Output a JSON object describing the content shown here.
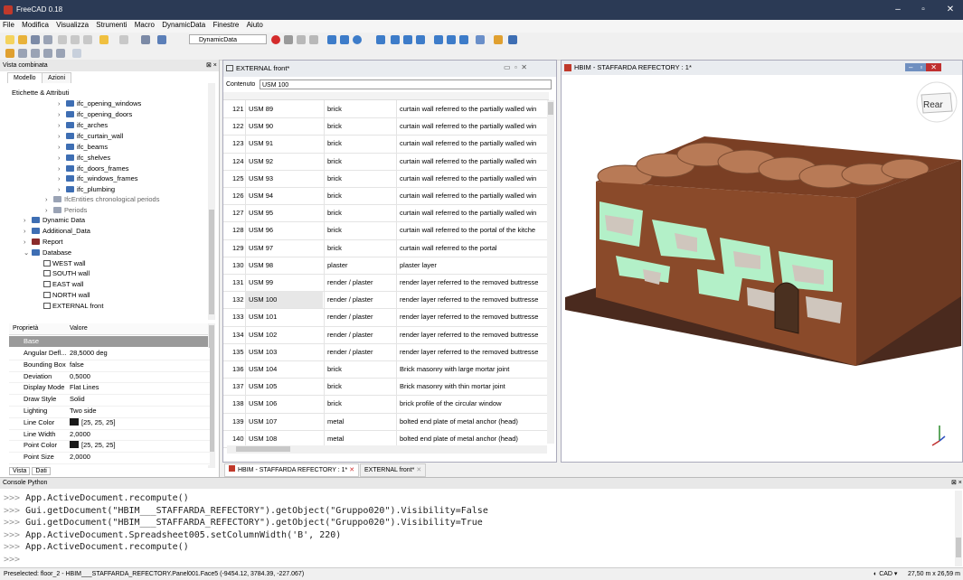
{
  "window": {
    "title": "FreeCAD 0.18",
    "min": "–",
    "max": "▫",
    "close": "✕"
  },
  "menu": [
    "File",
    "Modifica",
    "Visualizza",
    "Strumenti",
    "Macro",
    "DynamicData",
    "Finestre",
    "Aiuto"
  ],
  "toolbar": {
    "workbench": "DynamicData"
  },
  "combo": {
    "title": "Vista combinata",
    "tabs": [
      "Modello",
      "Azioni"
    ],
    "root": "Etichette & Attributi",
    "items": [
      "ifc_opening_windows",
      "ifc_opening_doors",
      "ifc_arches",
      "ifc_curtain_wall",
      "ifc_beams",
      "ifc_shelves",
      "ifc_doors_frames",
      "ifc_windows_frames",
      "ifc_plumbing",
      "IfcEntities chronological periods",
      "Periods",
      "Dynamic Data",
      "Additional_Data",
      "Report",
      "Database",
      "WEST wall",
      "SOUTH wall",
      "EAST wall",
      "NORTH wall",
      "EXTERNAL front"
    ]
  },
  "properties": {
    "col_prop": "Proprietà",
    "col_val": "Valore",
    "group": "Base",
    "rows": [
      {
        "k": "Angular Defl...",
        "v": "28,5000 deg"
      },
      {
        "k": "Bounding Box",
        "v": "false"
      },
      {
        "k": "Deviation",
        "v": "0,5000"
      },
      {
        "k": "Display Mode",
        "v": "Flat Lines"
      },
      {
        "k": "Draw Style",
        "v": "Solid"
      },
      {
        "k": "Lighting",
        "v": "Two side"
      },
      {
        "k": "Line Color",
        "v": "[25, 25, 25]"
      },
      {
        "k": "Line Width",
        "v": "2,0000"
      },
      {
        "k": "Point Color",
        "v": "[25, 25, 25]"
      },
      {
        "k": "Point Size",
        "v": "2,0000"
      }
    ],
    "tabs": [
      "Vista",
      "Dati"
    ]
  },
  "spreadsheet": {
    "title": "EXTERNAL front*",
    "content_label": "Contenuto",
    "content_value": "USM 100",
    "rows": [
      {
        "n": "121",
        "a": "USM 89",
        "b": "brick",
        "c": "curtain wall referred to the partially walled win"
      },
      {
        "n": "122",
        "a": "USM 90",
        "b": "brick",
        "c": "curtain wall referred to the partially walled win"
      },
      {
        "n": "123",
        "a": "USM 91",
        "b": "brick",
        "c": "curtain wall referred to the partially walled win"
      },
      {
        "n": "124",
        "a": "USM 92",
        "b": "brick",
        "c": "curtain wall referred to the partially walled win"
      },
      {
        "n": "125",
        "a": "USM 93",
        "b": "brick",
        "c": "curtain wall referred to the partially walled win"
      },
      {
        "n": "126",
        "a": "USM 94",
        "b": "brick",
        "c": "curtain wall referred to the partially walled win"
      },
      {
        "n": "127",
        "a": "USM 95",
        "b": "brick",
        "c": "curtain wall referred to the partially walled win"
      },
      {
        "n": "128",
        "a": "USM 96",
        "b": "brick",
        "c": "curtain wall referred to the portal of the kitche"
      },
      {
        "n": "129",
        "a": "USM 97",
        "b": "brick",
        "c": "curtain wall referred to the portal"
      },
      {
        "n": "130",
        "a": "USM 98",
        "b": "plaster",
        "c": "plaster layer"
      },
      {
        "n": "131",
        "a": "USM 99",
        "b": "render / plaster",
        "c": "render layer referred to the removed buttresse"
      },
      {
        "n": "132",
        "a": "USM 100",
        "b": "render / plaster",
        "c": "render layer referred to the removed buttresse"
      },
      {
        "n": "133",
        "a": "USM 101",
        "b": "render / plaster",
        "c": "render layer referred to the removed buttresse"
      },
      {
        "n": "134",
        "a": "USM 102",
        "b": "render / plaster",
        "c": "render layer referred to the removed buttresse"
      },
      {
        "n": "135",
        "a": "USM 103",
        "b": "render / plaster",
        "c": "render layer referred to the removed buttresse"
      },
      {
        "n": "136",
        "a": "USM 104",
        "b": "brick",
        "c": "Brick masonry with large mortar joint"
      },
      {
        "n": "137",
        "a": "USM 105",
        "b": "brick",
        "c": "Brick masonry with thin mortar joint"
      },
      {
        "n": "138",
        "a": "USM 106",
        "b": "brick",
        "c": "brick profile of the circular window"
      },
      {
        "n": "139",
        "a": "USM 107",
        "b": "metal",
        "c": "bolted end plate of metal anchor (head)"
      },
      {
        "n": "140",
        "a": "USM 108",
        "b": "metal",
        "c": "bolted end plate of metal anchor (head)"
      }
    ]
  },
  "doc_tabs": [
    "HBIM - STAFFARDA REFECTORY : 1*",
    "EXTERNAL front*"
  ],
  "view3d": {
    "title": "HBIM - STAFFARDA REFECTORY : 1*",
    "navcube": "Rear"
  },
  "console": {
    "title": "Console Python",
    "lines": [
      "App.ActiveDocument.recompute()",
      "Gui.getDocument(\"HBIM___STAFFARDA_REFECTORY\").getObject(\"Gruppo020\").Visibility=False",
      "Gui.getDocument(\"HBIM___STAFFARDA_REFECTORY\").getObject(\"Gruppo020\").Visibility=True",
      "App.ActiveDocument.Spreadsheet005.setColumnWidth('B', 220)",
      "App.ActiveDocument.recompute()",
      ""
    ]
  },
  "status": {
    "text": "Preselected: floor_2 - HBIM___STAFFARDA_REFECTORY.Panel001.Face5 (-9454.12, 3784.39, -227.067)",
    "nav": "CAD",
    "dims": "27,50 m x 26,59 m"
  },
  "colors": {
    "brick": "#8a4a2a",
    "render": "#b3f0c8",
    "stone": "#cfc6bd",
    "vault": "#b87a56",
    "base": "#4a2a1e"
  }
}
